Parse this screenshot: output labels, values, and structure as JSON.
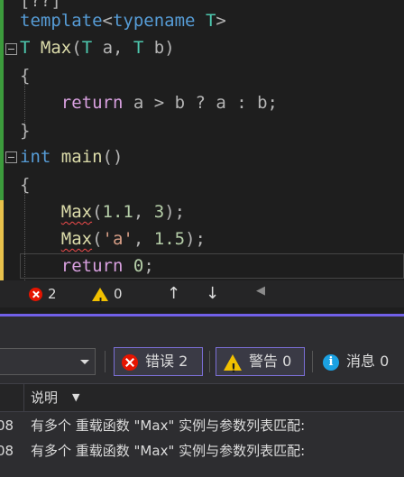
{
  "code": {
    "lines": [
      {
        "tokens": [
          {
            "t": "[??]",
            "c": "punc"
          }
        ]
      },
      {
        "tokens": [
          {
            "t": "template",
            "c": "kw"
          },
          {
            "t": "<",
            "c": "punc"
          },
          {
            "t": "typename",
            "c": "kw"
          },
          {
            "t": " ",
            "c": "punc"
          },
          {
            "t": "T",
            "c": "type"
          },
          {
            "t": ">",
            "c": "punc"
          }
        ]
      },
      {
        "tokens": [
          {
            "t": "T",
            "c": "type"
          },
          {
            "t": " ",
            "c": "punc"
          },
          {
            "t": "Max",
            "c": "fn"
          },
          {
            "t": "(",
            "c": "punc"
          },
          {
            "t": "T",
            "c": "type"
          },
          {
            "t": " a, ",
            "c": "punc"
          },
          {
            "t": "T",
            "c": "type"
          },
          {
            "t": " b)",
            "c": "punc"
          }
        ]
      },
      {
        "tokens": [
          {
            "t": "{",
            "c": "punc"
          }
        ]
      },
      {
        "tokens": [
          {
            "t": "    ",
            "c": "punc"
          },
          {
            "t": "return",
            "c": "kw2"
          },
          {
            "t": " a > b ? a : b;",
            "c": "punc"
          }
        ]
      },
      {
        "tokens": [
          {
            "t": "}",
            "c": "punc"
          }
        ]
      },
      {
        "tokens": [
          {
            "t": "int",
            "c": "kw"
          },
          {
            "t": " ",
            "c": "punc"
          },
          {
            "t": "main",
            "c": "fn"
          },
          {
            "t": "()",
            "c": "punc"
          }
        ]
      },
      {
        "tokens": [
          {
            "t": "{",
            "c": "punc"
          }
        ]
      },
      {
        "tokens": [
          {
            "t": "    ",
            "c": "punc"
          },
          {
            "t": "Max",
            "c": "fn squig"
          },
          {
            "t": "(",
            "c": "punc"
          },
          {
            "t": "1.1",
            "c": "num"
          },
          {
            "t": ", ",
            "c": "punc"
          },
          {
            "t": "3",
            "c": "num"
          },
          {
            "t": ");",
            "c": "punc"
          }
        ]
      },
      {
        "tokens": [
          {
            "t": "    ",
            "c": "punc"
          },
          {
            "t": "Max",
            "c": "fn squig"
          },
          {
            "t": "(",
            "c": "punc"
          },
          {
            "t": "'a'",
            "c": "str"
          },
          {
            "t": ", ",
            "c": "punc"
          },
          {
            "t": "1.5",
            "c": "num"
          },
          {
            "t": ");",
            "c": "punc"
          }
        ]
      },
      {
        "tokens": [
          {
            "t": "    ",
            "c": "punc"
          },
          {
            "t": "return",
            "c": "kw2"
          },
          {
            "t": " ",
            "c": "punc"
          },
          {
            "t": "0",
            "c": "num"
          },
          {
            "t": ";",
            "c": "punc"
          }
        ]
      }
    ]
  },
  "statusbar": {
    "error_count": "2",
    "warning_count": "0",
    "nav_up": "↑",
    "nav_down": "↓",
    "scroll_left": "◀"
  },
  "error_list": {
    "filter_errors": "错误 2",
    "filter_warnings": "警告 0",
    "filter_messages": "消息 0",
    "column_description": "说明",
    "sort_icon": "▼",
    "rows": [
      {
        "code": "08",
        "description": "有多个 重载函数 \"Max\" 实例与参数列表匹配:"
      },
      {
        "code": "08",
        "description": "有多个 重载函数 \"Max\" 实例与参数列表匹配:"
      }
    ]
  }
}
